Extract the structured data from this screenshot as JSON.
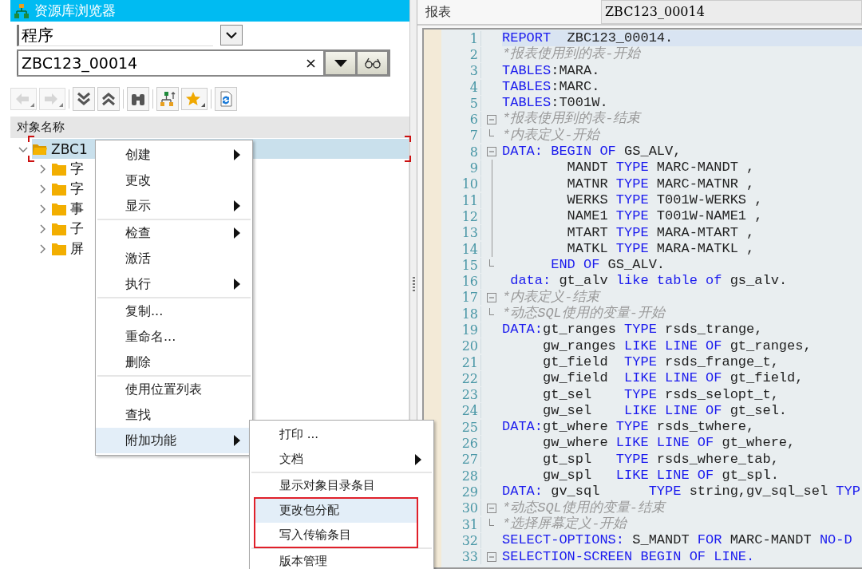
{
  "browser": {
    "title": "资源库浏览器",
    "object_type": {
      "value": "程序"
    },
    "object_name": {
      "value": "ZBC123_00014"
    },
    "toolbar": [
      {
        "kind": "back",
        "disabled": true,
        "dropdown": true
      },
      {
        "kind": "forward",
        "disabled": true,
        "dropdown": true
      },
      {
        "kind": "expand",
        "disabled": false,
        "dropdown": false
      },
      {
        "kind": "collapse",
        "disabled": false,
        "dropdown": false
      },
      {
        "kind": "find",
        "disabled": false,
        "dropdown": false
      },
      {
        "kind": "hierarchy",
        "disabled": false,
        "dropdown": false
      },
      {
        "kind": "favorite",
        "disabled": false,
        "dropdown": true
      },
      {
        "kind": "refresh",
        "disabled": false,
        "dropdown": false
      }
    ],
    "column_header": "对象名称",
    "tree": [
      {
        "label": "ZBC1",
        "expanded": true,
        "selected": true,
        "children": [
          {
            "label": "字",
            "expanded": false,
            "selected": false
          },
          {
            "label": "字",
            "expanded": false,
            "selected": false
          },
          {
            "label": "事",
            "expanded": false,
            "selected": false
          },
          {
            "label": "子",
            "expanded": false,
            "selected": false
          },
          {
            "label": "屏",
            "expanded": false,
            "selected": false
          }
        ]
      }
    ]
  },
  "context_menu": {
    "sections": [
      {
        "items": [
          {
            "label": "创建",
            "submenu": true,
            "selected": false
          },
          {
            "label": "更改",
            "submenu": false,
            "selected": false
          },
          {
            "label": "显示",
            "submenu": true,
            "selected": false
          }
        ]
      },
      {
        "items": [
          {
            "label": "检查",
            "submenu": true,
            "selected": false
          },
          {
            "label": "激活",
            "submenu": false,
            "selected": false
          },
          {
            "label": "执行",
            "submenu": true,
            "selected": false
          }
        ]
      },
      {
        "items": [
          {
            "label": "复制...",
            "submenu": false,
            "selected": false
          },
          {
            "label": "重命名...",
            "submenu": false,
            "selected": false
          },
          {
            "label": "删除",
            "submenu": false,
            "selected": false
          }
        ]
      },
      {
        "items": [
          {
            "label": "使用位置列表",
            "submenu": false,
            "selected": false
          },
          {
            "label": "查找",
            "submenu": false,
            "selected": false
          },
          {
            "label": "附加功能",
            "submenu": true,
            "selected": true
          }
        ]
      }
    ]
  },
  "submenu": {
    "sections": [
      {
        "items": [
          {
            "label": "打印 ...",
            "submenu": false,
            "selected": false,
            "outlined": false
          },
          {
            "label": "文档",
            "submenu": true,
            "selected": false,
            "outlined": false
          }
        ]
      },
      {
        "items": [
          {
            "label": "显示对象目录条目",
            "submenu": false,
            "selected": false,
            "outlined": false
          },
          {
            "label": "更改包分配",
            "submenu": false,
            "selected": true,
            "outlined": true
          },
          {
            "label": "写入传输条目",
            "submenu": false,
            "selected": false,
            "outlined": true
          }
        ]
      },
      {
        "items": [
          {
            "label": "版本管理",
            "submenu": false,
            "selected": false,
            "outlined": false
          }
        ]
      }
    ]
  },
  "editor": {
    "label": "报表",
    "program": "ZBC123_00014",
    "lines": [
      {
        "no": "1",
        "kind": "plain",
        "selected": true,
        "tokens": [
          {
            "kind": "keyword",
            "text": "REPORT"
          },
          {
            "kind": "plain",
            "text": "  ZBC123_00014."
          }
        ]
      },
      {
        "no": "2",
        "kind": "plain",
        "selected": false,
        "tokens": [
          {
            "kind": "comment",
            "text": "*报表使用到的表-开始"
          }
        ]
      },
      {
        "no": "3",
        "kind": "plain",
        "selected": false,
        "tokens": [
          {
            "kind": "keyword",
            "text": "TABLES"
          },
          {
            "kind": "plain",
            "text": ":MARA."
          }
        ]
      },
      {
        "no": "4",
        "kind": "plain",
        "selected": false,
        "tokens": [
          {
            "kind": "keyword",
            "text": "TABLES"
          },
          {
            "kind": "plain",
            "text": ":MARC."
          }
        ]
      },
      {
        "no": "5",
        "kind": "plain",
        "selected": false,
        "tokens": [
          {
            "kind": "keyword",
            "text": "TABLES"
          },
          {
            "kind": "plain",
            "text": ":T001W."
          }
        ]
      },
      {
        "no": "6",
        "kind": "opener",
        "selected": false,
        "tokens": [
          {
            "kind": "comment",
            "text": "*报表使用到的表-结束"
          }
        ]
      },
      {
        "no": "7",
        "kind": "closer",
        "selected": false,
        "tokens": [
          {
            "kind": "comment",
            "text": "*内表定义-开始"
          }
        ]
      },
      {
        "no": "8",
        "kind": "opener",
        "selected": false,
        "tokens": [
          {
            "kind": "keyword",
            "text": "DATA: BEGIN OF"
          },
          {
            "kind": "plain",
            "text": " GS_ALV,"
          }
        ]
      },
      {
        "no": "9",
        "kind": "inner",
        "selected": false,
        "tokens": [
          {
            "kind": "plain",
            "text": "        MANDT "
          },
          {
            "kind": "keyword",
            "text": "TYPE"
          },
          {
            "kind": "plain",
            "text": " MARC-MANDT ,"
          }
        ]
      },
      {
        "no": "10",
        "kind": "inner",
        "selected": false,
        "tokens": [
          {
            "kind": "plain",
            "text": "        MATNR "
          },
          {
            "kind": "keyword",
            "text": "TYPE"
          },
          {
            "kind": "plain",
            "text": " MARC-MATNR ,"
          }
        ]
      },
      {
        "no": "11",
        "kind": "inner",
        "selected": false,
        "tokens": [
          {
            "kind": "plain",
            "text": "        WERKS "
          },
          {
            "kind": "keyword",
            "text": "TYPE"
          },
          {
            "kind": "plain",
            "text": " T001W-WERKS ,"
          }
        ]
      },
      {
        "no": "12",
        "kind": "inner",
        "selected": false,
        "tokens": [
          {
            "kind": "plain",
            "text": "        NAME1 "
          },
          {
            "kind": "keyword",
            "text": "TYPE"
          },
          {
            "kind": "plain",
            "text": " T001W-NAME1 ,"
          }
        ]
      },
      {
        "no": "13",
        "kind": "inner",
        "selected": false,
        "tokens": [
          {
            "kind": "plain",
            "text": "        MTART "
          },
          {
            "kind": "keyword",
            "text": "TYPE"
          },
          {
            "kind": "plain",
            "text": " MARA-MTART ,"
          }
        ]
      },
      {
        "no": "14",
        "kind": "inner",
        "selected": false,
        "tokens": [
          {
            "kind": "plain",
            "text": "        MATKL "
          },
          {
            "kind": "keyword",
            "text": "TYPE"
          },
          {
            "kind": "plain",
            "text": " MARA-MATKL ,"
          }
        ]
      },
      {
        "no": "15",
        "kind": "closer",
        "selected": false,
        "tokens": [
          {
            "kind": "keyword",
            "text": "      END OF"
          },
          {
            "kind": "plain",
            "text": " GS_ALV."
          }
        ]
      },
      {
        "no": "16",
        "kind": "plain",
        "selected": false,
        "tokens": [
          {
            "kind": "keyword",
            "text": " data:"
          },
          {
            "kind": "plain",
            "text": " gt_alv "
          },
          {
            "kind": "keyword",
            "text": "like table of"
          },
          {
            "kind": "plain",
            "text": " gs_alv."
          }
        ]
      },
      {
        "no": "17",
        "kind": "opener",
        "selected": false,
        "tokens": [
          {
            "kind": "comment",
            "text": "*内表定义-结束"
          }
        ]
      },
      {
        "no": "18",
        "kind": "closer",
        "selected": false,
        "tokens": [
          {
            "kind": "comment",
            "text": "*动态SQL使用的变量-开始"
          }
        ]
      },
      {
        "no": "19",
        "kind": "plain",
        "selected": false,
        "tokens": [
          {
            "kind": "keyword",
            "text": "DATA:"
          },
          {
            "kind": "plain",
            "text": "gt_ranges "
          },
          {
            "kind": "keyword",
            "text": "TYPE"
          },
          {
            "kind": "plain",
            "text": " rsds_trange,"
          }
        ]
      },
      {
        "no": "20",
        "kind": "plain",
        "selected": false,
        "tokens": [
          {
            "kind": "plain",
            "text": "     gw_ranges "
          },
          {
            "kind": "keyword",
            "text": "LIKE LINE OF"
          },
          {
            "kind": "plain",
            "text": " gt_ranges,"
          }
        ]
      },
      {
        "no": "21",
        "kind": "plain",
        "selected": false,
        "tokens": [
          {
            "kind": "plain",
            "text": "     gt_field  "
          },
          {
            "kind": "keyword",
            "text": "TYPE"
          },
          {
            "kind": "plain",
            "text": " rsds_frange_t,"
          }
        ]
      },
      {
        "no": "22",
        "kind": "plain",
        "selected": false,
        "tokens": [
          {
            "kind": "plain",
            "text": "     gw_field  "
          },
          {
            "kind": "keyword",
            "text": "LIKE LINE OF"
          },
          {
            "kind": "plain",
            "text": " gt_field,"
          }
        ]
      },
      {
        "no": "23",
        "kind": "plain",
        "selected": false,
        "tokens": [
          {
            "kind": "plain",
            "text": "     gt_sel    "
          },
          {
            "kind": "keyword",
            "text": "TYPE"
          },
          {
            "kind": "plain",
            "text": " rsds_selopt_t,"
          }
        ]
      },
      {
        "no": "24",
        "kind": "plain",
        "selected": false,
        "tokens": [
          {
            "kind": "plain",
            "text": "     gw_sel    "
          },
          {
            "kind": "keyword",
            "text": "LIKE LINE OF"
          },
          {
            "kind": "plain",
            "text": " gt_sel."
          }
        ]
      },
      {
        "no": "25",
        "kind": "plain",
        "selected": false,
        "tokens": [
          {
            "kind": "keyword",
            "text": "DATA:"
          },
          {
            "kind": "plain",
            "text": "gt_where "
          },
          {
            "kind": "keyword",
            "text": "TYPE"
          },
          {
            "kind": "plain",
            "text": " rsds_twhere,"
          }
        ]
      },
      {
        "no": "26",
        "kind": "plain",
        "selected": false,
        "tokens": [
          {
            "kind": "plain",
            "text": "     gw_where "
          },
          {
            "kind": "keyword",
            "text": "LIKE LINE OF"
          },
          {
            "kind": "plain",
            "text": " gt_where,"
          }
        ]
      },
      {
        "no": "27",
        "kind": "plain",
        "selected": false,
        "tokens": [
          {
            "kind": "plain",
            "text": "     gt_spl   "
          },
          {
            "kind": "keyword",
            "text": "TYPE"
          },
          {
            "kind": "plain",
            "text": " rsds_where_tab,"
          }
        ]
      },
      {
        "no": "28",
        "kind": "plain",
        "selected": false,
        "tokens": [
          {
            "kind": "plain",
            "text": "     gw_spl   "
          },
          {
            "kind": "keyword",
            "text": "LIKE LINE OF"
          },
          {
            "kind": "plain",
            "text": " gt_spl."
          }
        ]
      },
      {
        "no": "29",
        "kind": "plain",
        "selected": false,
        "tokens": [
          {
            "kind": "keyword",
            "text": "DATA:"
          },
          {
            "kind": "plain",
            "text": " gv_sql      "
          },
          {
            "kind": "keyword",
            "text": "TYPE"
          },
          {
            "kind": "plain",
            "text": " string,gv_sql_sel "
          },
          {
            "kind": "keyword",
            "text": "TYP"
          }
        ]
      },
      {
        "no": "30",
        "kind": "opener",
        "selected": false,
        "tokens": [
          {
            "kind": "comment",
            "text": "*动态SQL使用的变量-结束"
          }
        ]
      },
      {
        "no": "31",
        "kind": "closer",
        "selected": false,
        "tokens": [
          {
            "kind": "comment",
            "text": "*选择屏幕定义-开始"
          }
        ]
      },
      {
        "no": "32",
        "kind": "plain",
        "selected": false,
        "tokens": [
          {
            "kind": "keyword",
            "text": "SELECT-OPTIONS:"
          },
          {
            "kind": "plain",
            "text": " S_MANDT "
          },
          {
            "kind": "keyword",
            "text": "FOR"
          },
          {
            "kind": "plain",
            "text": " MARC-MANDT "
          },
          {
            "kind": "keyword",
            "text": "NO-D"
          }
        ]
      },
      {
        "no": "33",
        "kind": "opener",
        "selected": false,
        "tokens": [
          {
            "kind": "keyword",
            "text": "SELECTION-SCREEN BEGIN OF LINE."
          }
        ]
      }
    ]
  }
}
